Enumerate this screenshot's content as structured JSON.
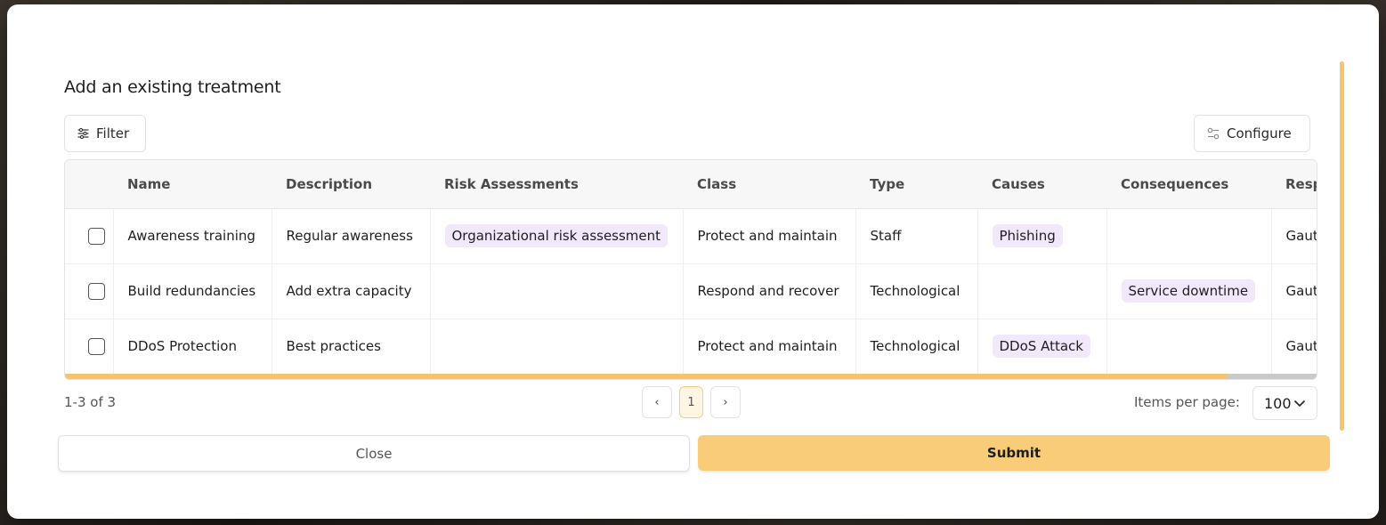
{
  "modal": {
    "title": "Add an existing treatment",
    "filter_label": "Filter",
    "configure_label": "Configure"
  },
  "table": {
    "columns": [
      "Name",
      "Description",
      "Risk Assessments",
      "Class",
      "Type",
      "Causes",
      "Consequences",
      "Resp"
    ],
    "rows": [
      {
        "name": "Awareness training",
        "description": "Regular awareness",
        "risk_assessment": "Organizational risk assessment",
        "class": "Protect and maintain",
        "type": "Staff",
        "cause": "Phishing",
        "consequence": "",
        "responsible": "Gaut"
      },
      {
        "name": "Build redundancies",
        "description": "Add extra capacity",
        "risk_assessment": "",
        "class": "Respond and recover",
        "type": "Technological",
        "cause": "",
        "consequence": "Service downtime",
        "responsible": "Gaut"
      },
      {
        "name": "DDoS Protection",
        "description": "Best practices",
        "risk_assessment": "",
        "class": "Protect and maintain",
        "type": "Technological",
        "cause": "DDoS Attack",
        "consequence": "",
        "responsible": "Gaut"
      }
    ]
  },
  "pagination": {
    "range_text": "1-3 of 3",
    "prev_icon": "‹",
    "current_page": "1",
    "next_icon": "›",
    "items_per_page_label": "Items per page:",
    "items_per_page_value": "100"
  },
  "footer": {
    "close_label": "Close",
    "submit_label": "Submit"
  },
  "colors": {
    "accent": "#f8cc79",
    "tag_bg": "#f1e8fb"
  }
}
